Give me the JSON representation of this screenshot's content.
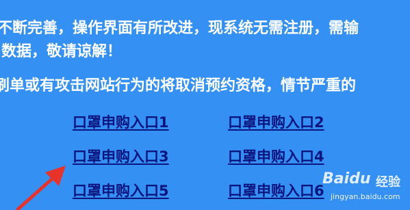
{
  "notice": {
    "line1": "不断完善，操作界面有所改进，现系统无需注册，需输",
    "line2": "数据，敬请谅解！",
    "line3": "刷单或有攻击网站行为的将取消预约资格，情节严重的"
  },
  "links": [
    {
      "label": "口罩申购入口1"
    },
    {
      "label": "口罩申购入口2"
    },
    {
      "label": "口罩申购入口3"
    },
    {
      "label": "口罩申购入口4"
    },
    {
      "label": "口罩申购入口5"
    },
    {
      "label": "口罩申购入口6"
    }
  ],
  "annotation": {
    "arrow_color": "#e8332a"
  },
  "watermark": {
    "logo": "Baidu",
    "brand": "经验",
    "url": "jingyan.baidu.com"
  },
  "colors": {
    "background": "#3590f3",
    "notice_text": "#ffffff",
    "link_text": "#0a1580"
  }
}
